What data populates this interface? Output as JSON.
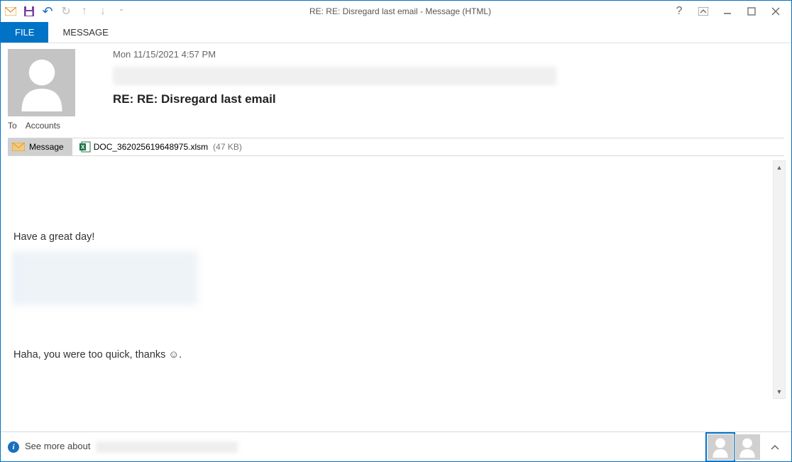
{
  "window": {
    "title": "RE: RE: Disregard last email - Message (HTML)"
  },
  "ribbon": {
    "tabs": [
      {
        "label": "FILE",
        "active": true
      },
      {
        "label": "MESSAGE",
        "active": false
      }
    ]
  },
  "email": {
    "date": "Mon 11/15/2021 4:57 PM",
    "subject": "RE: RE: Disregard last email",
    "to_label": "To",
    "to_value": "Accounts"
  },
  "attachment": {
    "message_label": "Message",
    "file_name": "DOC_362025619648975.xlsm",
    "file_size": "(47 KB)"
  },
  "body": {
    "line1": "Have a great day!",
    "line2": "Haha, you were too quick, thanks ☺."
  },
  "footer": {
    "see_more": "See more about"
  }
}
